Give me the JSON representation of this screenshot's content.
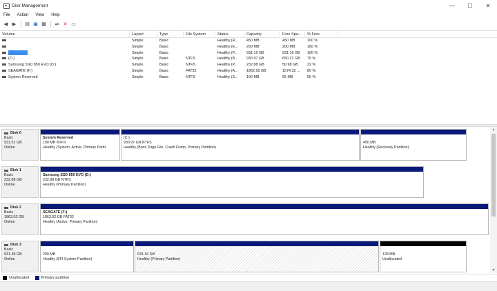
{
  "window": {
    "title": "Disk Management",
    "controls": {
      "minimize": "—",
      "maximize": "☐",
      "close": "✕"
    }
  },
  "menu": [
    "File",
    "Action",
    "View",
    "Help"
  ],
  "toolbar": {
    "icons": [
      "back-arrow-icon",
      "forward-arrow-icon",
      "disk-list-icon",
      "help-icon",
      "properties-icon",
      "connect-icon",
      "delete-icon",
      "settings-icon"
    ]
  },
  "volume_table": {
    "columns": [
      "Volume",
      "Layout",
      "Type",
      "File System",
      "Status",
      "Capacity",
      "Free Spa...",
      "% Free"
    ],
    "rows": [
      {
        "volume": "",
        "layout": "Simple",
        "type": "Basic",
        "fs": "",
        "status": "Healthy (R...",
        "capacity": "450 MB",
        "free": "450 MB",
        "pct": "100 %"
      },
      {
        "volume": "",
        "layout": "Simple",
        "type": "Basic",
        "fs": "",
        "status": "Healthy (E...",
        "capacity": "200 MB",
        "free": "200 MB",
        "pct": "100 %"
      },
      {
        "volume": "",
        "layout": "Simple",
        "type": "Basic",
        "fs": "",
        "status": "Healthy (P...",
        "capacity": "931.16 GB",
        "free": "931.16 GB",
        "pct": "100 %"
      },
      {
        "volume": "(C:)",
        "layout": "Simple",
        "type": "Basic",
        "fs": "NTFS",
        "status": "Healthy (B...",
        "capacity": "930.97 GB",
        "free": "650.22 GB",
        "pct": "70 %"
      },
      {
        "volume": "Samsung SSD 850 EVO (D:)",
        "layout": "Simple",
        "type": "Basic",
        "fs": "NTFS",
        "status": "Healthy (P...",
        "capacity": "232.88 GB",
        "free": "50.98 GB",
        "pct": "22 %"
      },
      {
        "volume": "SEAGATE (F:)",
        "layout": "Simple",
        "type": "Basic",
        "fs": "FAT32",
        "status": "Healthy (A...",
        "capacity": "1862.56 GB",
        "free": "1574.32 ...",
        "pct": "85 %"
      },
      {
        "volume": "System Reserved",
        "layout": "Simple",
        "type": "Basic",
        "fs": "NTFS",
        "status": "Healthy (S...",
        "capacity": "100 MB",
        "free": "55 MB",
        "pct": "55 %"
      }
    ]
  },
  "disks": [
    {
      "name": "Disk 0",
      "type": "Basic",
      "size": "931.51 GB",
      "status": "Online",
      "partitions": [
        {
          "name": "System Reserved",
          "size": "100 MB NTFS",
          "status": "Healthy (System, Active, Primary Partit"
        },
        {
          "name": "(C:)",
          "size": "930.97 GB NTFS",
          "status": "Healthy (Boot, Page File, Crash Dump, Primary Partition)"
        },
        {
          "name": "",
          "size": "450 MB",
          "status": "Healthy (Recovery Partition)"
        }
      ]
    },
    {
      "name": "Disk 1",
      "type": "Basic",
      "size": "232.88 GB",
      "status": "Online",
      "partitions": [
        {
          "name": "Samsung SSD 850 EVO  (D:)",
          "size": "232.88 GB NTFS",
          "status": "Healthy (Primary Partition)"
        }
      ]
    },
    {
      "name": "Disk 2",
      "type": "Basic",
      "size": "1863.02 GB",
      "status": "Online",
      "partitions": [
        {
          "name": "SEAGATE  (F:)",
          "size": "1863.02 GB FAT32",
          "status": "Healthy (Active, Primary Partition)"
        }
      ]
    },
    {
      "name": "Disk 3",
      "type": "Basic",
      "size": "931.48 GB",
      "status": "Online",
      "partitions": [
        {
          "name": "",
          "size": "200 MB",
          "status": "Healthy (EFI System Partition)"
        },
        {
          "name": "",
          "size": "931.16 GB",
          "status": "Healthy (Primary Partition)"
        },
        {
          "name": "",
          "size": "128 MB",
          "status": "Unallocated"
        }
      ]
    }
  ],
  "legend": [
    {
      "label": "Unallocated",
      "color": "#000000"
    },
    {
      "label": "Primary partition",
      "color": "#0a1a78"
    }
  ],
  "colors": {
    "primary": "#0a1a78",
    "unallocated": "#000000",
    "selection": "#3d8cef"
  }
}
